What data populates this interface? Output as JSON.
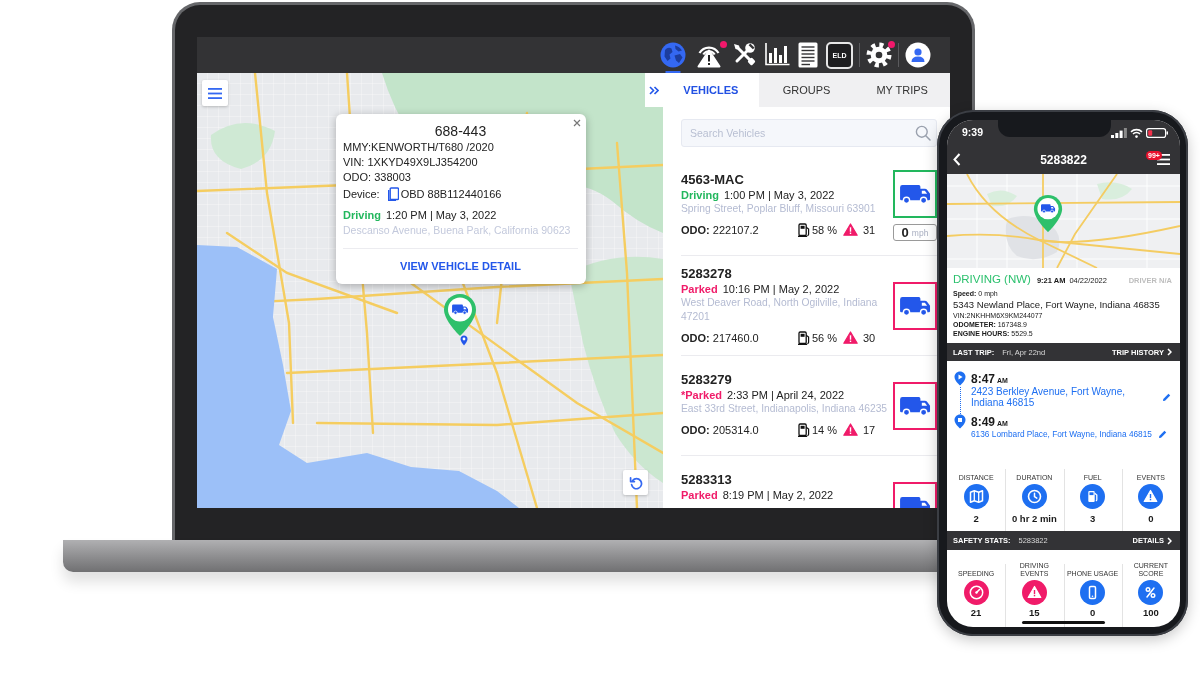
{
  "laptop": {
    "toolbar": {
      "items": [
        {
          "kind": "globe",
          "selected": true,
          "alert": false
        },
        {
          "kind": "tower",
          "selected": false,
          "alert": true
        },
        {
          "kind": "tools",
          "selected": false,
          "alert": false
        },
        {
          "kind": "chart",
          "selected": false,
          "alert": false
        },
        {
          "kind": "report",
          "selected": false,
          "alert": false
        },
        {
          "kind": "eld",
          "label": "ELD",
          "selected": false,
          "alert": false
        },
        {
          "kind": "gear",
          "selected": false,
          "alert": true
        },
        {
          "kind": "avatar",
          "selected": false,
          "alert": false
        }
      ]
    },
    "popup": {
      "title": "688-443",
      "lines": [
        "MMY:KENWORTH/T680 /2020",
        "VIN: 1XKYD49X9LJ354200",
        "ODO: 338003"
      ],
      "device_label": "Device:",
      "device": "OBD 88B112440166",
      "status": {
        "kind": "driving",
        "label": "Driving",
        "time": "1:20 PM | May 3, 2022"
      },
      "address": "Descanso Avenue, Buena Park, California 90623",
      "link": "VIEW VEHICLE DETAIL"
    },
    "panel": {
      "tabs": [
        {
          "label": "VEHICLES",
          "selected": true
        },
        {
          "label": "GROUPS",
          "selected": false
        },
        {
          "label": "MY TRIPS",
          "selected": false
        }
      ],
      "search": {
        "placeholder": "Search Vehicles"
      },
      "vehicles": [
        {
          "id": "4563-MAC",
          "kind": "driving",
          "status": "Driving",
          "time": "1:00 PM | May 3, 2022",
          "address": "Spring Street, Poplar Bluff, Missouri 63901",
          "odo": "**ODO:** 222107.2",
          "fuel": "58 %",
          "events": "31",
          "speed": "0",
          "speed_unit": "mph"
        },
        {
          "id": "5283278",
          "kind": "parked",
          "status": "Parked",
          "time": "10:16 PM | May 2, 2022",
          "address": "West Deaver Road, North Ogilville, Indiana 47201",
          "odo": "**ODO:** 217460.0",
          "fuel": "56 %",
          "events": "30"
        },
        {
          "id": "5283279",
          "kind": "parked",
          "status": "*Parked",
          "time": "2:33 PM | April 24, 2022",
          "address": "East 33rd Street, Indianapolis, Indiana 46235",
          "odo": "**ODO:** 205314.0",
          "fuel": "14 %",
          "events": "17"
        },
        {
          "id": "5283313",
          "kind": "parked",
          "status": "Parked",
          "time": "8:19 PM | May 2, 2022"
        }
      ]
    }
  },
  "phone": {
    "status_bar": {
      "time": "9:39"
    },
    "header": {
      "title": "5283822",
      "badge": "99+"
    },
    "status": {
      "kind": "driving",
      "label": "DRIVING (NW)",
      "time": "9:21 AM",
      "date": "04/22/2022",
      "driver": "DRIVER N/A"
    },
    "speed": "**Speed:** 0 mph",
    "address": "5343 Newland Place, Fort Wayne, Indiana 46835",
    "details": [
      "VIN:2NKHHM6X9KM244077",
      "**ODOMETER:** 167348.9",
      "**ENGINE HOURS:** 5529.5"
    ],
    "last_trip": {
      "label": "LAST TRIP:",
      "date": "Fri, Apr 22nd",
      "link": "TRIP HISTORY"
    },
    "stops": [
      {
        "kind": "start",
        "time": "8:47",
        "meridiem": "AM",
        "address": "2423 Berkley Avenue, Fort Wayne, Indiana 46815"
      },
      {
        "kind": "end",
        "time": "8:49",
        "meridiem": "AM",
        "address": "6136 Lombard Place, Fort Wayne, Indiana 46815"
      }
    ],
    "trip_stats": [
      {
        "kind": "distance",
        "label": "DISTANCE",
        "value": "2"
      },
      {
        "kind": "duration",
        "label": "DURATION",
        "value": "0 hr 2 min"
      },
      {
        "kind": "fuel",
        "label": "FUEL",
        "value": "3"
      },
      {
        "kind": "events",
        "label": "EVENTS",
        "value": "0"
      }
    ],
    "safety": {
      "label": "SAFETY STATS:",
      "id": "5283822",
      "link": "DETAILS"
    },
    "safety_stats": [
      {
        "kind": "speeding",
        "label": "SPEEDING",
        "color": "#f01b69",
        "value": "21"
      },
      {
        "kind": "driving-events",
        "label": "DRIVING EVENTS",
        "color": "#f01b69",
        "value": "15"
      },
      {
        "kind": "phone-usage",
        "label": "PHONE USAGE",
        "color": "#1e6ff1",
        "value": "0"
      },
      {
        "kind": "score",
        "label": "CURRENT SCORE",
        "color": "#1e6ff1",
        "value": "100"
      }
    ]
  }
}
